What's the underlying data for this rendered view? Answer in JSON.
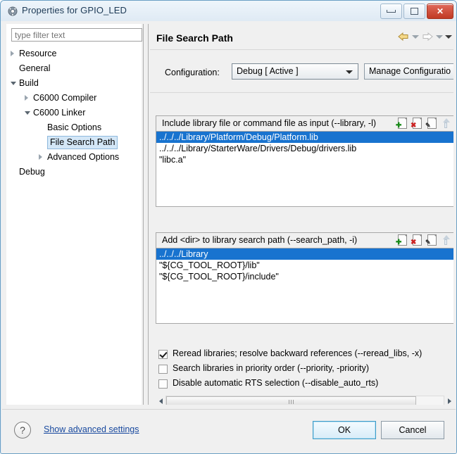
{
  "window": {
    "title": "Properties for GPIO_LED",
    "icon": "properties-gear-icon",
    "controls": {
      "minimize": "minimize-icon",
      "maximize": "maximize-icon",
      "close": "✕"
    }
  },
  "sidebar": {
    "filter": {
      "placeholder": "type filter text",
      "value": ""
    },
    "items": [
      {
        "label": "Resource",
        "indent": 0,
        "arrow": "collapsed",
        "selected": false
      },
      {
        "label": "General",
        "indent": 0,
        "arrow": "none",
        "selected": false
      },
      {
        "label": "Build",
        "indent": 0,
        "arrow": "expanded",
        "selected": false
      },
      {
        "label": "C6000 Compiler",
        "indent": 1,
        "arrow": "collapsed",
        "selected": false
      },
      {
        "label": "C6000 Linker",
        "indent": 1,
        "arrow": "expanded",
        "selected": false
      },
      {
        "label": "Basic Options",
        "indent": 2,
        "arrow": "none",
        "selected": false
      },
      {
        "label": "File Search Path",
        "indent": 2,
        "arrow": "none",
        "selected": true
      },
      {
        "label": "Advanced Options",
        "indent": 2,
        "arrow": "collapsed",
        "selected": false
      },
      {
        "label": "Debug",
        "indent": 0,
        "arrow": "none",
        "selected": false
      }
    ]
  },
  "page": {
    "title": "File Search Path",
    "nav": {
      "back": "back-arrow-icon",
      "back_menu": "chevron-down-icon",
      "forward": "forward-arrow-icon",
      "forward_menu": "chevron-down-icon",
      "view_menu": "chevron-down-icon"
    },
    "configuration": {
      "label": "Configuration:",
      "value": "Debug  [ Active ]",
      "manage_button": "Manage Configuratio"
    },
    "lists": [
      {
        "header": "Include library file or command file as input (--library, -l)",
        "tools": [
          "add-icon",
          "delete-icon",
          "edit-icon",
          "move-up-icon"
        ],
        "items": [
          {
            "text": "../../../Library/Platform/Debug/Platform.lib",
            "selected": true
          },
          {
            "text": "../../../Library/StarterWare/Drivers/Debug/drivers.lib",
            "selected": false
          },
          {
            "text": "\"libc.a\"",
            "selected": false
          }
        ]
      },
      {
        "header": "Add <dir> to library search path (--search_path, -i)",
        "tools": [
          "add-icon",
          "delete-icon",
          "edit-icon",
          "move-up-icon"
        ],
        "items": [
          {
            "text": "../../../Library",
            "selected": true
          },
          {
            "text": "\"${CG_TOOL_ROOT}/lib\"",
            "selected": false
          },
          {
            "text": "\"${CG_TOOL_ROOT}/include\"",
            "selected": false
          }
        ]
      }
    ],
    "checkboxes": [
      {
        "label": "Reread libraries; resolve backward references (--reread_libs, -x)",
        "checked": true
      },
      {
        "label": "Search libraries in priority order (--priority, -priority)",
        "checked": false
      },
      {
        "label": "Disable automatic RTS selection (--disable_auto_rts)",
        "checked": false
      }
    ]
  },
  "footer": {
    "help": "?",
    "advanced_link": "Show advanced settings",
    "ok": "OK",
    "cancel": "Cancel"
  },
  "colors": {
    "selection": "#1873cf",
    "link": "#17489e",
    "close_button": "#c13a24",
    "tree_selection": "#d4e7f7"
  }
}
